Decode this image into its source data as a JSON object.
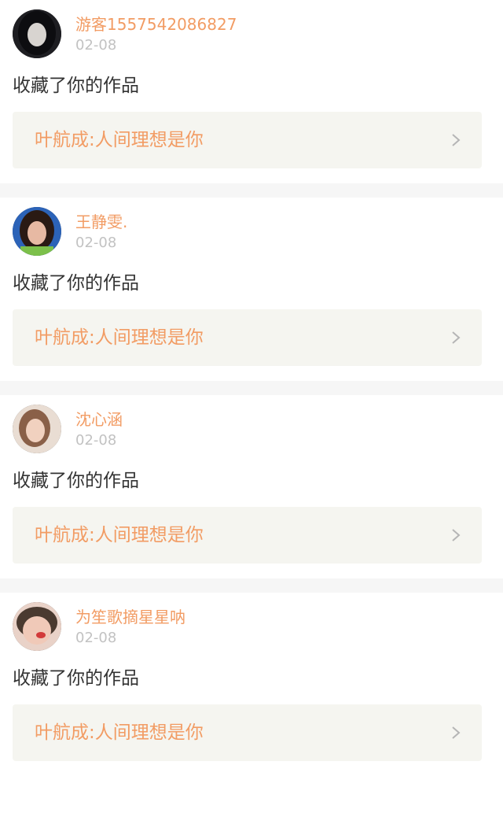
{
  "items": [
    {
      "username": "游客1557542086827",
      "time": "02-08",
      "action": "收藏了你的作品",
      "work_title": "叶航成:人间理想是你",
      "avatar": {
        "bg": "#1e1e22",
        "face": "#d8d4d0",
        "hair": "#0d0d10"
      }
    },
    {
      "username": "王静雯.",
      "time": "02-08",
      "action": "收藏了你的作品",
      "work_title": "叶航成:人间理想是你",
      "avatar": {
        "bg": "#2c63b8",
        "face": "#e7b9a3",
        "hair": "#2a1a14"
      }
    },
    {
      "username": "沈心涵",
      "time": "02-08",
      "action": "收藏了你的作品",
      "work_title": "叶航成:人间理想是你",
      "avatar": {
        "bg": "#e9ddd3",
        "face": "#f1d1bf",
        "hair": "#8a6048"
      }
    },
    {
      "username": "为笙歌摘星星呐",
      "time": "02-08",
      "action": "收藏了你的作品",
      "work_title": "叶航成:人间理想是你",
      "avatar": {
        "bg": "#e9d2c8",
        "face": "#f0c9b8",
        "hair": "#4a3a30"
      }
    }
  ],
  "colors": {
    "accent": "#f29c64",
    "time_gray": "#c2c2c2",
    "card_bg": "#f5f5f0",
    "separator": "#f6f6f6"
  },
  "icons": {
    "chevron": "chevron-right-icon",
    "avatar": "user-avatar"
  }
}
